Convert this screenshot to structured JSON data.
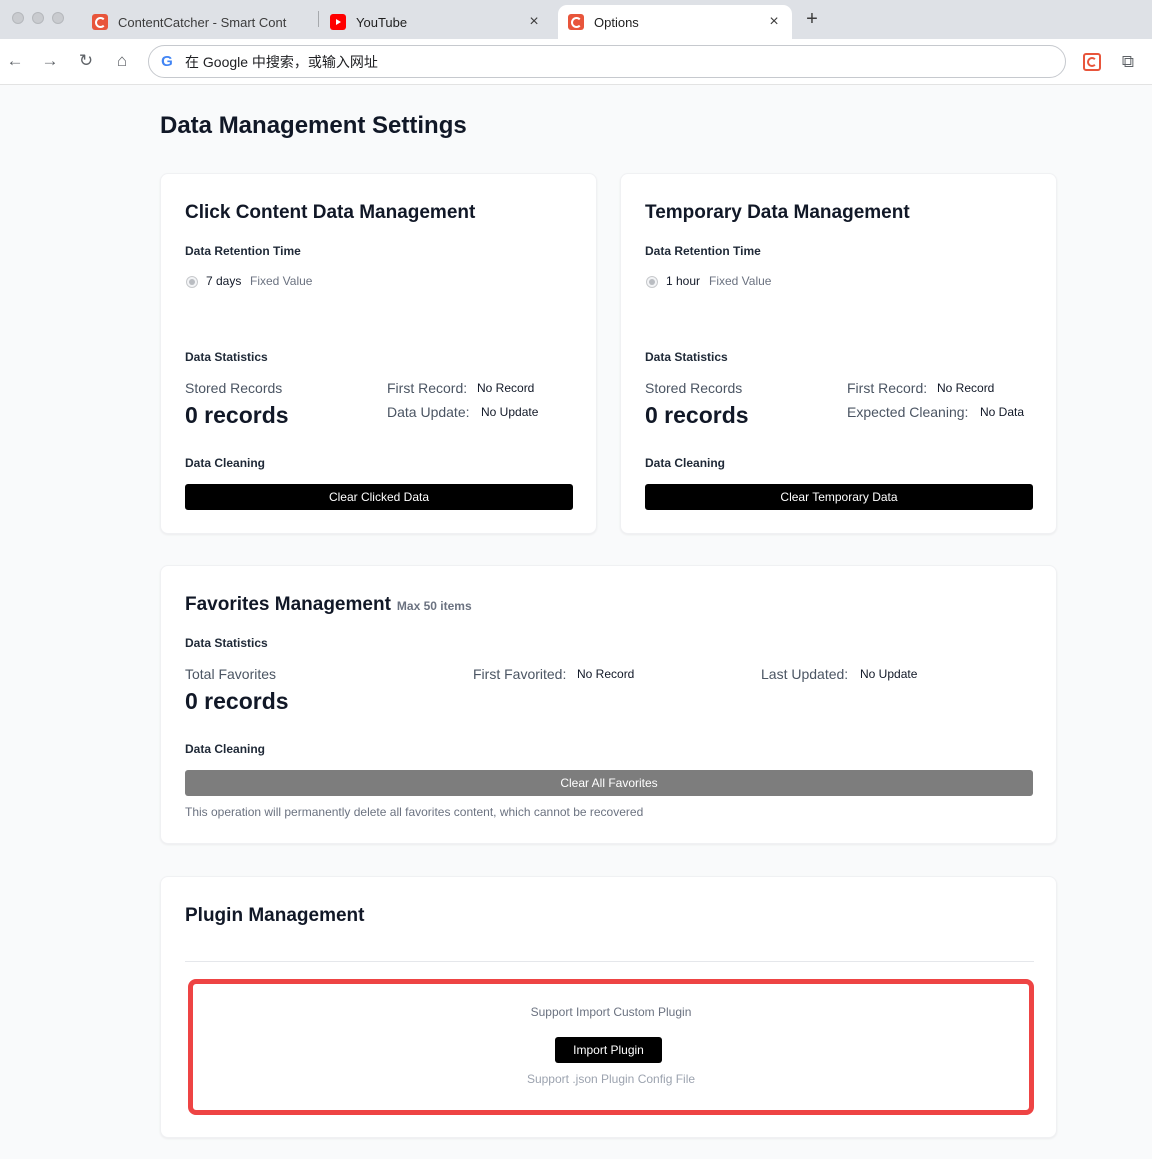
{
  "browser": {
    "tabs": [
      {
        "title": "ContentCatcher - Smart Cont",
        "favicon": "contentcatcher-icon"
      },
      {
        "title": "YouTube",
        "favicon": "youtube-icon"
      },
      {
        "title": "Options",
        "favicon": "contentcatcher-icon",
        "active": true
      }
    ],
    "new_tab_label": "+",
    "close_label": "×",
    "omnibox_placeholder": "在 Google 中搜索，或输入网址",
    "google_letter": "G"
  },
  "page": {
    "title": "Data Management Settings"
  },
  "click_card": {
    "title": "Click Content Data Management",
    "retention_label": "Data Retention Time",
    "retention_value": "7 days",
    "fixed_label": "Fixed Value",
    "stats_label": "Data Statistics",
    "stored_label": "Stored Records",
    "stored_value": "0 records",
    "first_record_key": "First Record:",
    "first_record_val": "No Record",
    "update_key": "Data Update:",
    "update_val": "No Update",
    "cleaning_label": "Data Cleaning",
    "clear_button": "Clear Clicked Data"
  },
  "temp_card": {
    "title": "Temporary Data Management",
    "retention_label": "Data Retention Time",
    "retention_value": "1 hour",
    "fixed_label": "Fixed Value",
    "stats_label": "Data Statistics",
    "stored_label": "Stored Records",
    "stored_value": "0 records",
    "first_record_key": "First Record:",
    "first_record_val": "No Record",
    "cleaning_key": "Expected Cleaning:",
    "cleaning_val": "No Data",
    "cleaning_label": "Data Cleaning",
    "clear_button": "Clear Temporary Data"
  },
  "favorites_card": {
    "title": "Favorites Management",
    "max_note": "Max 50 items",
    "stats_label": "Data Statistics",
    "total_label": "Total Favorites",
    "total_value": "0 records",
    "first_key": "First Favorited:",
    "first_val": "No Record",
    "last_key": "Last Updated:",
    "last_val": "No Update",
    "cleaning_label": "Data Cleaning",
    "clear_button": "Clear All Favorites",
    "warning": "This operation will permanently delete all favorites content, which cannot be recovered"
  },
  "plugin_card": {
    "title": "Plugin Management",
    "support_text": "Support Import Custom Plugin",
    "import_button": "Import Plugin",
    "format_text": "Support .json Plugin Config File"
  },
  "colors": {
    "highlight_border": "#ee4444",
    "primary_button": "#000000",
    "disabled_button": "#7d7d7d",
    "brand": "#e8553b"
  }
}
